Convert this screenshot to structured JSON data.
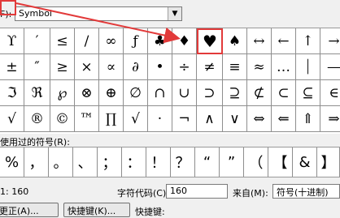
{
  "font_row": {
    "label": "F):",
    "value": "Symbol"
  },
  "grid": [
    [
      "ϒ",
      "′",
      "≤",
      "∕",
      "∞",
      "ƒ",
      "♣",
      "♦",
      "♥",
      "♠",
      "↔",
      "←",
      "↑",
      "→"
    ],
    [
      "±",
      "″",
      "≥",
      "×",
      "∝",
      "∂",
      "•",
      "÷",
      "≠",
      "≡",
      "≈",
      "…",
      "⏐",
      "—"
    ],
    [
      "ℑ",
      "ℜ",
      "℘",
      "⊗",
      "⊕",
      "∅",
      "∩",
      "∪",
      "⊃",
      "⊇",
      "⊄",
      "⊂",
      "⊆",
      "∈"
    ],
    [
      "√",
      "®",
      "©",
      "™",
      "∏",
      "√",
      "·",
      "¬",
      "∧",
      "∨",
      "⇔",
      "⇐",
      "⇑",
      "⇒"
    ]
  ],
  "selected_symbol": "♥",
  "recent_label": "使用过的符号(R):",
  "recent": [
    "%",
    "，",
    "。",
    "、",
    "；",
    "：",
    "！",
    "？",
    "“",
    "”",
    "（",
    "【",
    "&",
    "】"
  ],
  "code_row": {
    "left_text": "1: 160",
    "char_code_label": "字符代码(C):",
    "char_code_value": "160",
    "from_label": "来自(M):",
    "from_value": "符号(十进制)"
  },
  "buttons": {
    "autocorrect": "更正(A)...",
    "shortcut_key": "快捷键(K)...",
    "shortcut_label": "快捷键:"
  }
}
